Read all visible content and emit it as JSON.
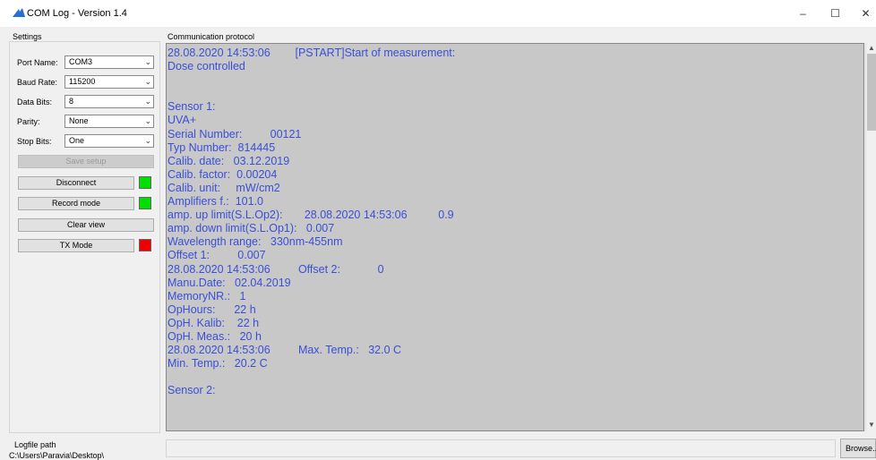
{
  "window": {
    "title": "COM Log - Version 1.4",
    "minimize": "–",
    "maximize": "☐",
    "close": "✕"
  },
  "settings": {
    "group_label": "Settings",
    "fields": [
      {
        "label": "Port Name:",
        "value": "COM3"
      },
      {
        "label": "Baud Rate:",
        "value": "115200"
      },
      {
        "label": "Data Bits:",
        "value": "8"
      },
      {
        "label": "Parity:",
        "value": "None"
      },
      {
        "label": "Stop Bits:",
        "value": "One"
      }
    ],
    "save_setup": "Save setup",
    "disconnect": "Disconnect",
    "record_mode": "Record mode",
    "clear_view": "Clear view",
    "tx_mode": "TX Mode"
  },
  "indicators": {
    "disconnect_color": "#00e000",
    "record_color": "#00e000",
    "tx_color": "#ee0000"
  },
  "protocol": {
    "label": "Communication protocol",
    "lines": [
      "28.08.2020 14:53:06        [PSTART]Start of measurement:",
      "Dose controlled",
      "",
      "",
      "Sensor 1:",
      "UVA+",
      "Serial Number:         00121",
      "Typ Number:  814445",
      "Calib. date:   03.12.2019",
      "Calib. factor:  0.00204",
      "Calib. unit:     mW/cm2",
      "Amplifiers f.:  101.0",
      "amp. up limit(S.L.Op2):       28.08.2020 14:53:06          0.9",
      "amp. down limit(S.L.Op1):   0.007",
      "Wavelength range:   330nm-455nm",
      "Offset 1:         0.007",
      "28.08.2020 14:53:06         Offset 2:            0",
      "Manu.Date:   02.04.2019",
      "MemoryNR.:   1",
      "OpHours:      22 h",
      "OpH. Kalib:    22 h",
      "OpH. Meas.:   20 h",
      "28.08.2020 14:53:06         Max. Temp.:   32.0 C",
      "Min. Temp.:   20.2 C",
      "",
      "Sensor 2:"
    ]
  },
  "logfile": {
    "label": "Logfile path",
    "path": "C:\\Users\\Paravia\\Desktop\\",
    "browse": "Browse..."
  }
}
